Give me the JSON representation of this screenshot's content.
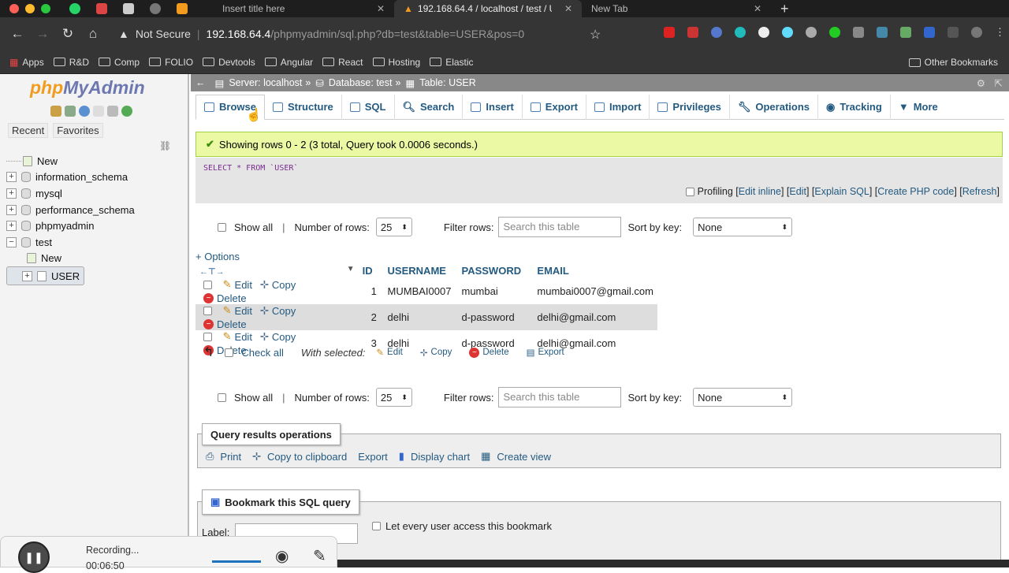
{
  "browser": {
    "tabs": [
      {
        "title": "Insert title here",
        "active": false
      },
      {
        "title": "192.168.64.4 / localhost / test / U",
        "active": true
      },
      {
        "title": "New Tab",
        "active": false
      }
    ],
    "url_warning": "Not Secure",
    "url_host": "192.168.64.4",
    "url_path": "/phpmyadmin/sql.php?db=test&table=USER&pos=0",
    "bookmarks": [
      "Apps",
      "R&D",
      "Comp",
      "FOLIO",
      "Devtools",
      "Angular",
      "React",
      "Hosting",
      "Elastic"
    ],
    "other_bookmarks": "Other Bookmarks"
  },
  "sidebar": {
    "logo_php": "php",
    "logo_admin": "MyAdmin",
    "tabs": [
      "Recent",
      "Favorites"
    ],
    "tree": [
      {
        "label": "New",
        "level": 0
      },
      {
        "label": "information_schema",
        "level": 0
      },
      {
        "label": "mysql",
        "level": 0
      },
      {
        "label": "performance_schema",
        "level": 0
      },
      {
        "label": "phpmyadmin",
        "level": 0
      },
      {
        "label": "test",
        "level": 0
      },
      {
        "label": "New",
        "level": 1
      },
      {
        "label": "USER",
        "level": 1
      }
    ]
  },
  "breadcrumb": {
    "server": "Server: localhost",
    "database": "Database: test",
    "table": "Table: USER"
  },
  "menu": [
    "Browse",
    "Structure",
    "SQL",
    "Search",
    "Insert",
    "Export",
    "Import",
    "Privileges",
    "Operations",
    "Tracking",
    "More"
  ],
  "success_message": "Showing rows 0 - 2 (3 total, Query took 0.0006 seconds.)",
  "sql_query": "SELECT * FROM `USER`",
  "profiling": {
    "label": "Profiling",
    "links": [
      "Edit inline",
      "Edit",
      "Explain SQL",
      "Create PHP code",
      "Refresh"
    ]
  },
  "nav": {
    "show_all": "Show all",
    "rows_label": "Number of rows:",
    "rows_value": "25",
    "filter_label": "Filter rows:",
    "filter_placeholder": "Search this table",
    "sort_label": "Sort by key:",
    "sort_value": "None"
  },
  "options_link": "+ Options",
  "table": {
    "columns": [
      "ID",
      "USERNAME",
      "PASSWORD",
      "EMAIL"
    ],
    "actions": [
      "Edit",
      "Copy",
      "Delete"
    ],
    "rows": [
      [
        "1",
        "MUMBAI0007",
        "mumbai",
        "mumbai0007@gmail.com"
      ],
      [
        "2",
        "delhi",
        "d-password",
        "delhi@gmail.com"
      ],
      [
        "3",
        "delhi",
        "d-password",
        "delhi@gmail.com"
      ]
    ]
  },
  "with_selected": {
    "check_all": "Check all",
    "label": "With selected:",
    "actions": [
      "Edit",
      "Copy",
      "Delete",
      "Export"
    ]
  },
  "query_ops": {
    "title": "Query results operations",
    "actions": [
      "Print",
      "Copy to clipboard",
      "Export",
      "Display chart",
      "Create view"
    ]
  },
  "bookmark": {
    "title": "Bookmark this SQL query",
    "label": "Label:",
    "checkbox": "Let every user access this bookmark"
  },
  "recording": {
    "status": "Recording...",
    "time": "00:06:50"
  }
}
